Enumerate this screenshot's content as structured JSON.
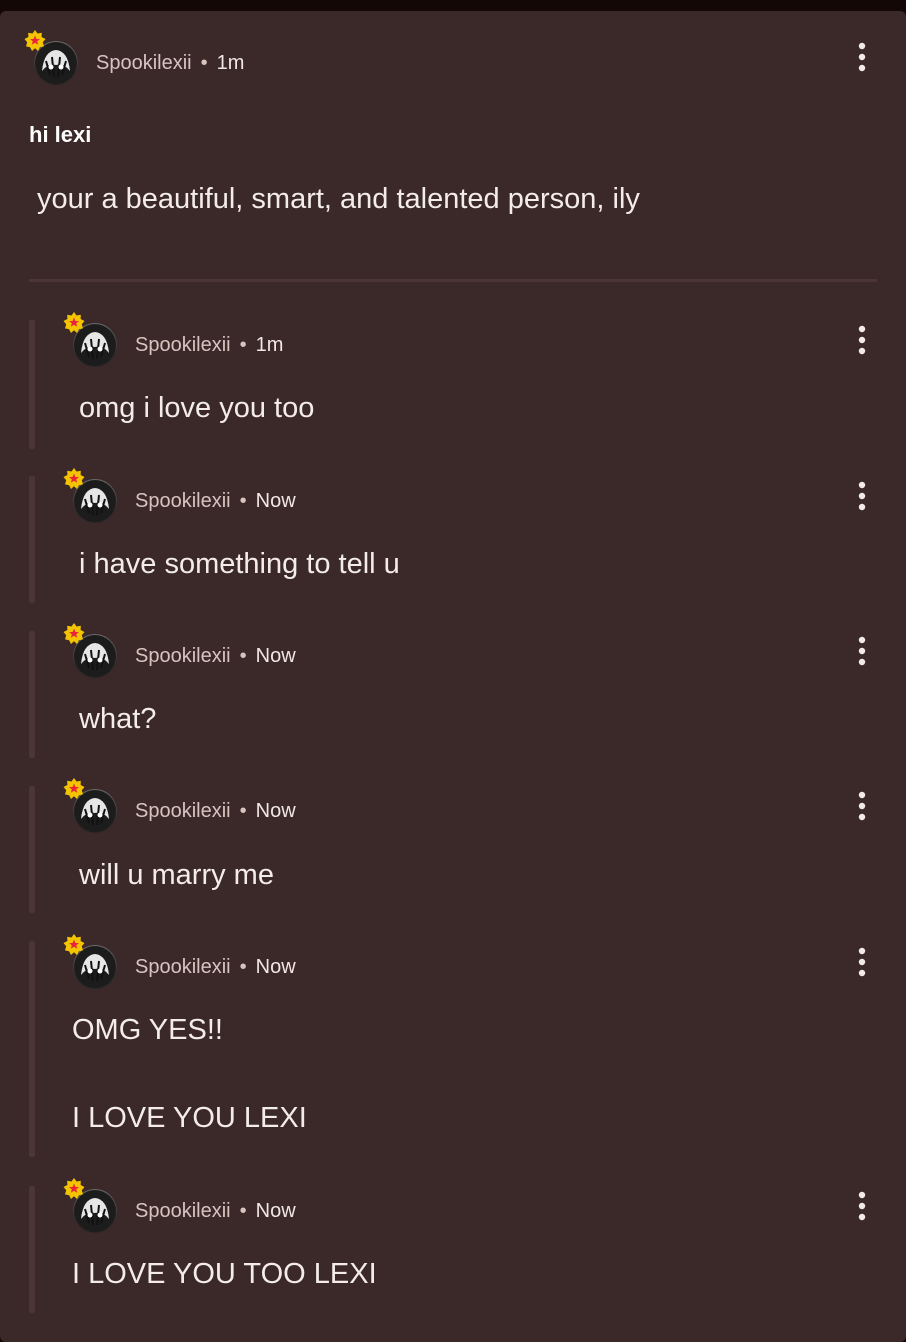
{
  "post": {
    "author": "Spookilexii",
    "separator": "•",
    "time": "1m",
    "title": "hi lexi",
    "body": "your a beautiful, smart, and talented person, ily"
  },
  "replies": [
    {
      "author": "Spookilexii",
      "separator": "•",
      "time": "1m",
      "lines": [
        "omg i love you too"
      ]
    },
    {
      "author": "Spookilexii",
      "separator": "•",
      "time": "Now",
      "lines": [
        "i have something to tell u"
      ]
    },
    {
      "author": "Spookilexii",
      "separator": "•",
      "time": "Now",
      "lines": [
        "what?"
      ]
    },
    {
      "author": "Spookilexii",
      "separator": "•",
      "time": "Now",
      "lines": [
        "will u marry me"
      ]
    },
    {
      "author": "Spookilexii",
      "separator": "•",
      "time": "Now",
      "lines": [
        "OMG YES!!",
        "I LOVE YOU LEXI"
      ]
    },
    {
      "author": "Spookilexii",
      "separator": "•",
      "time": "Now",
      "lines": [
        "I LOVE YOU TOO LEXI"
      ]
    }
  ],
  "icons": {
    "avatar": "user-avatar",
    "badge": "star-badge-icon",
    "menu": "more-vertical-icon"
  },
  "colors": {
    "background": "#3b2829",
    "badge": "#f5c400",
    "star": "#e8233b",
    "meta_text": "#d8c4bf"
  }
}
